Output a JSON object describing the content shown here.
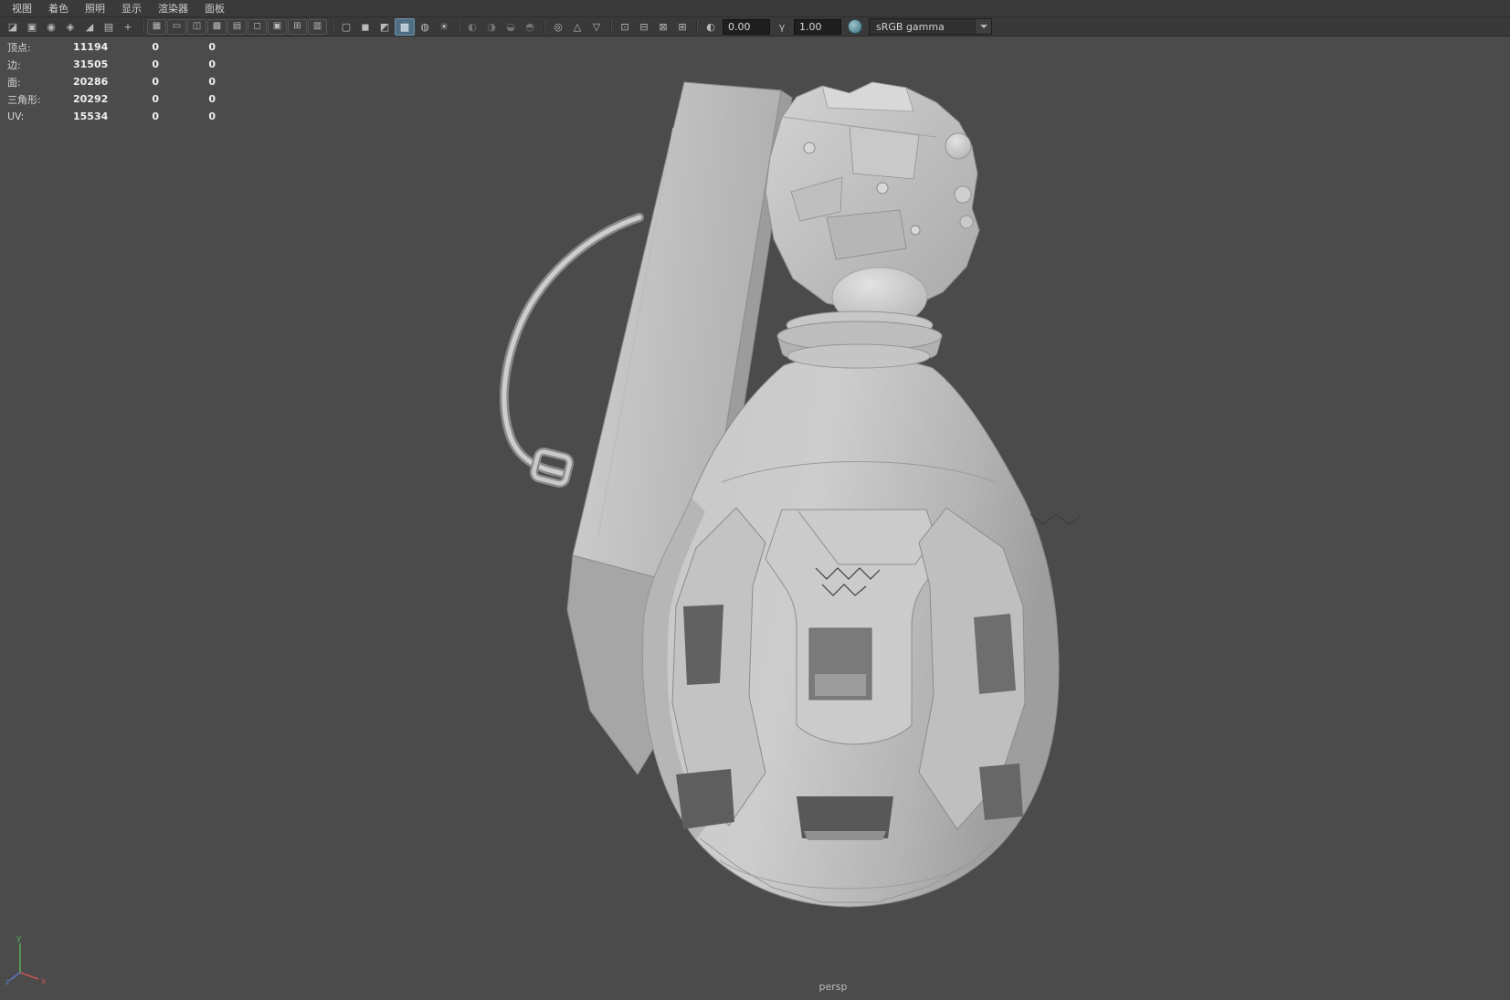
{
  "menu_bar": {
    "items": [
      "视图",
      "着色",
      "照明",
      "显示",
      "渲染器",
      "面板"
    ]
  },
  "toolbar": {
    "exposure_value": "0.00",
    "gamma_value": "1.00",
    "view_transform_label": "sRGB gamma",
    "icons": [
      {
        "name": "view-layout-icon",
        "glyph": "◪"
      },
      {
        "name": "select-camera-icon",
        "glyph": "▣"
      },
      {
        "name": "lock-camera-icon",
        "glyph": "◉"
      },
      {
        "name": "camera-attributes-icon",
        "glyph": "◈"
      },
      {
        "name": "bookmark-icon",
        "glyph": "◢"
      },
      {
        "name": "image-plane-icon",
        "glyph": "▤"
      },
      {
        "name": "two-d-pan-zoom-icon",
        "glyph": "+"
      },
      {
        "name": "grid-icon",
        "glyph": "▦"
      },
      {
        "name": "film-gate-icon",
        "glyph": "▭"
      },
      {
        "name": "resolution-gate-icon",
        "glyph": "◫"
      },
      {
        "name": "gate-mask-icon",
        "glyph": "▩"
      },
      {
        "name": "field-chart-icon",
        "glyph": "▤"
      },
      {
        "name": "safe-action-icon",
        "glyph": "◻"
      },
      {
        "name": "safe-title-icon",
        "glyph": "▣"
      },
      {
        "name": "frame-all-icon",
        "glyph": "⊞"
      },
      {
        "name": "camera-settings-icon",
        "glyph": "▥"
      },
      {
        "name": "wireframe-icon",
        "glyph": "▢"
      },
      {
        "name": "shaded-icon",
        "glyph": "◼"
      },
      {
        "name": "shaded-wireframe-icon",
        "glyph": "◩"
      },
      {
        "name": "textured-icon",
        "glyph": "▩"
      },
      {
        "name": "material-override-icon",
        "glyph": "◍"
      },
      {
        "name": "default-lighting-icon",
        "glyph": "☀"
      },
      {
        "name": "shadows-icon",
        "glyph": "◐"
      },
      {
        "name": "ambient-occlusion-icon",
        "glyph": "◑"
      },
      {
        "name": "motion-blur-icon",
        "glyph": "◒"
      },
      {
        "name": "depth-of-field-icon",
        "glyph": "◓"
      },
      {
        "name": "isolate-select-icon",
        "glyph": "◎"
      },
      {
        "name": "xray-icon",
        "glyph": "△"
      },
      {
        "name": "backface-culling-icon",
        "glyph": "▽"
      },
      {
        "name": "snap-to-grid-icon",
        "glyph": "⊡"
      },
      {
        "name": "pan-tool-icon",
        "glyph": "⊟"
      },
      {
        "name": "zoom-tool-icon",
        "glyph": "⊠"
      },
      {
        "name": "fit-view-icon",
        "glyph": "⊞"
      },
      {
        "name": "exposure-icon",
        "glyph": "◐"
      },
      {
        "name": "gamma-icon",
        "glyph": "γ"
      },
      {
        "name": "view-transform-icon",
        "glyph": "●"
      }
    ]
  },
  "hud": {
    "rows": [
      {
        "label": "顶点:",
        "value": "11194",
        "col2": "0",
        "col3": "0"
      },
      {
        "label": "边:",
        "value": "31505",
        "col2": "0",
        "col3": "0"
      },
      {
        "label": "面:",
        "value": "20286",
        "col2": "0",
        "col3": "0"
      },
      {
        "label": "三角形:",
        "value": "20292",
        "col2": "0",
        "col3": "0"
      },
      {
        "label": "UV:",
        "value": "15534",
        "col2": "0",
        "col3": "0"
      }
    ]
  },
  "viewport": {
    "camera_label": "persp",
    "axis_labels": {
      "x": "x",
      "y": "y",
      "z": "z"
    }
  },
  "colors": {
    "viewport_bg": "#4b4b4b",
    "toolbar_bg": "#393939",
    "menu_bg": "#3a3a3a",
    "field_bg": "#1f1f1f",
    "active_icon_bg": "#4f6e84",
    "axis_x": "#c65353",
    "axis_y": "#58b158",
    "axis_z": "#5b79c9",
    "model_gray": "#c4c4c4"
  }
}
